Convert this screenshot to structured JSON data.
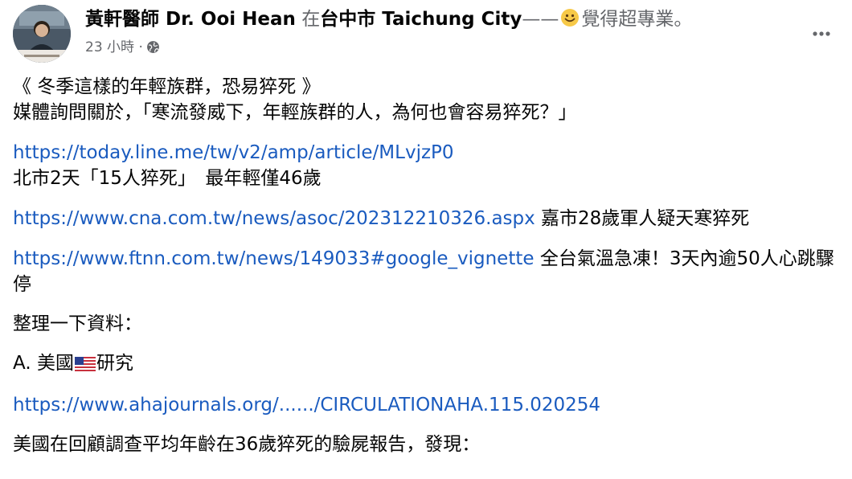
{
  "post": {
    "author": {
      "name": "黃軒醫師 Dr. Ooi Hean",
      "at_word": "在",
      "location": "台中市 Taichung City",
      "dash": "——",
      "feeling_icon": "smiling-face-icon",
      "feeling": "覺得超專業。"
    },
    "meta": {
      "time": "23 小時",
      "separator": "·",
      "privacy_icon": "globe-icon"
    },
    "more_icon": "more-options-icon",
    "body": {
      "title": "《 冬季這樣的年輕族群，恐易猝死 》",
      "intro": "媒體詢問關於，「寒流發威下，年輕族群的人，為何也會容易猝死？」",
      "link1": "https://today.line.me/tw/v2/amp/article/MLvjzP0",
      "link1_caption": "北市2天「15人猝死」　最年輕僅46歲",
      "link2": "https://www.cna.com.tw/news/asoc/202312210326.aspx",
      "link2_caption": " 嘉市28歲軍人疑天寒猝死",
      "link3": "https://www.ftnn.com.tw/news/149033#google_vignette",
      "link3_caption": " 全台氣溫急凍！3天內逾50人心跳驟停",
      "summary": "整理一下資料：",
      "section_a_prefix": "A. 美國",
      "section_a_flag": "us-flag-icon",
      "section_a_suffix": "研究",
      "link4": "https://www.ahajournals.org/....../CIRCULATIONAHA.115.020254",
      "finding": "美國在回顧調查平均年齡在36歲猝死的驗屍報告，發現："
    }
  },
  "colors": {
    "text": "#050505",
    "muted": "#65676b",
    "link": "#1a5bbf"
  }
}
